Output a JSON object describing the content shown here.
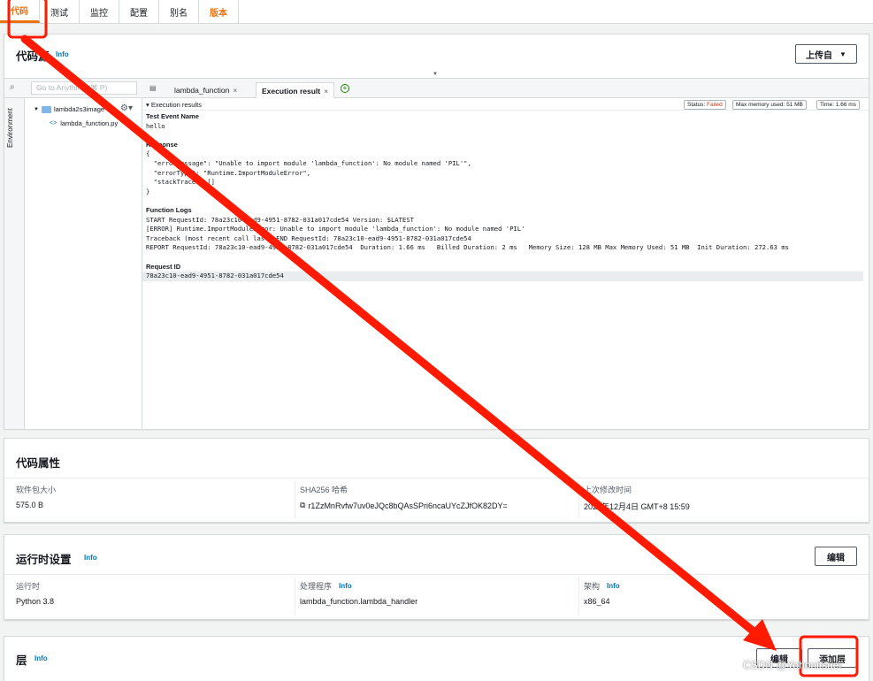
{
  "tabs": [
    "代码",
    "测试",
    "监控",
    "配置",
    "别名",
    "版本"
  ],
  "code_source": {
    "title": "代码源",
    "info": "Info",
    "upload_button": "上传自",
    "search_placeholder": "Go to Anything (⌘ P)",
    "environment_label": "Environment",
    "folder_name": "lambda2s3image",
    "file_name": "lambda_function.py",
    "editor_tabs": [
      "lambda_function",
      "Execution result"
    ],
    "exec_title": "Execution results",
    "status_label": "Status:",
    "status_value": "Failed",
    "max_memory": "Max memory used: 51 MB",
    "time": "Time: 1.66 ms",
    "test_event_heading": "Test Event Name",
    "test_event_value": "hello",
    "response_heading": "Response",
    "response_lines": [
      "{",
      "  \"errorMessage\": \"Unable to import module 'lambda_function': No module named 'PIL'\",",
      "  \"errorType\": \"Runtime.ImportModuleError\",",
      "  \"stackTrace\": []",
      "}"
    ],
    "logs_heading": "Function Logs",
    "log_lines": [
      "START RequestId: 78a23c10-ead9-4951-8782-031a017cde54 Version: $LATEST",
      "[ERROR] Runtime.ImportModuleError: Unable to import module 'lambda_function': No module named 'PIL'",
      "Traceback (most recent call last):END RequestId: 78a23c10-ead9-4951-8782-031a017cde54",
      "REPORT RequestId: 78a23c10-ead9-4951-8782-031a017cde54  Duration: 1.66 ms   Billed Duration: 2 ms   Memory Size: 128 MB Max Memory Used: 51 MB  Init Duration: 272.63 ms"
    ],
    "request_id_heading": "Request ID",
    "request_id": "78a23c10-ead9-4951-8782-031a017cde54"
  },
  "code_properties": {
    "title": "代码属性",
    "size_label": "软件包大小",
    "size_value": "575.0 B",
    "sha_label": "SHA256 哈希",
    "sha_value": "r1ZzMnRvfw7uv0eJQc8bQAsSPri6ncaUYcZJfOK82DY=",
    "modified_label": "上次修改时间",
    "modified_value": "2022年12月4日 GMT+8 15:59"
  },
  "runtime_settings": {
    "title": "运行时设置",
    "info": "Info",
    "edit_button": "编辑",
    "runtime_label": "运行时",
    "runtime_value": "Python 3.8",
    "handler_label": "处理程序",
    "handler_value": "lambda_function.lambda_handler",
    "arch_label": "架构",
    "arch_value": "x86_64"
  },
  "layers": {
    "title": "层",
    "info": "Info",
    "edit_button": "编辑",
    "add_button": "添加层"
  },
  "watermark": "CSDN @Yohonitsuei",
  "colors": {
    "accent": "#ec7211",
    "link": "#0073bb",
    "annotation": "#ff1a00"
  }
}
